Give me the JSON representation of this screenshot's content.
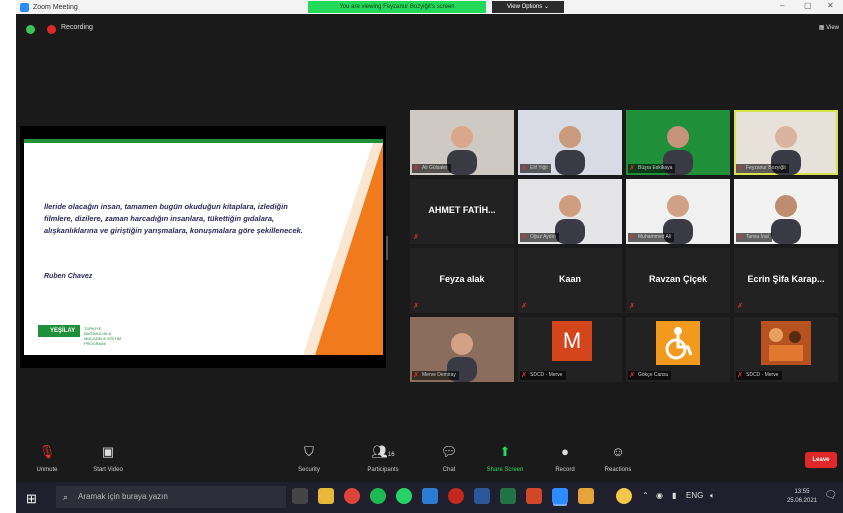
{
  "window": {
    "title": "Zoom Meeting",
    "viewing_banner": "You are viewing Feyzanur Bozyiğit's screen",
    "view_options": "View Options ⌄",
    "minimize": "–",
    "maximize": "▢",
    "close": "✕"
  },
  "meeting": {
    "recording_label": "Recording",
    "view_label": "View"
  },
  "slide": {
    "quote": "İleride olacağın insan, tamamen bugün okuduğun kitaplara, izlediğin filmlere, dizilere, zaman harcadığın insanlara, tükettiğin gıdalara, alışkanlıklarına ve giriştiğin yarışmalara, konuşmalara göre şekillenecek.",
    "author": "Ruben Chavez",
    "logo_text": "YEŞİLAY",
    "logo_sub": "TÜRKİYE BAĞIMLILIKLA MÜCADELE EĞİTİM PROGRAMI"
  },
  "participants": [
    {
      "name": "Ali Gülsaler",
      "label": "Ali Gülsaler",
      "type": "video",
      "bg": "#cfc9c4",
      "skin": "#d9a88a",
      "active": false
    },
    {
      "name": "Elif Yiğit",
      "label": "Elif Yiğit",
      "type": "video",
      "bg": "#d8dbe3",
      "skin": "#c99a7d",
      "active": false
    },
    {
      "name": "Büşra Eskikaya",
      "label": "Büşra Eskikaya",
      "type": "video",
      "bg": "#1f8f3a",
      "skin": "#c7937b",
      "active": false
    },
    {
      "name": "Feyzanur Bozyiğit",
      "label": "Feyzanur Bozyiğit",
      "type": "video",
      "bg": "#e8e1da",
      "skin": "#d8b3a0",
      "active": true
    },
    {
      "name": "AHMET FATİH...",
      "label": "",
      "type": "name",
      "active": false
    },
    {
      "name": "Oğuz Aydın",
      "label": "Oğuz Aydın",
      "type": "video",
      "bg": "#e5e5e8",
      "skin": "#cf9d80",
      "active": false
    },
    {
      "name": "Muhammed Ali",
      "label": "Muhammed Ali",
      "type": "video",
      "bg": "#f0f0f0",
      "skin": "#d0a186",
      "active": false
    },
    {
      "name": "Tansu İnal",
      "label": "Tansu İnal",
      "type": "video",
      "bg": "#f2f2f2",
      "skin": "#c08c70",
      "active": false
    },
    {
      "name": "Feyza alak",
      "label": "",
      "type": "name",
      "active": false
    },
    {
      "name": "Kaan",
      "label": "",
      "type": "name",
      "active": false
    },
    {
      "name": "Ravzan Çiçek",
      "label": "",
      "type": "name",
      "active": false
    },
    {
      "name": "Ecrin Şifa Karap...",
      "label": "",
      "type": "name",
      "active": false
    },
    {
      "name": "Merve Demiray",
      "label": "Merve Demiray",
      "type": "video",
      "bg": "#8a6d5c",
      "skin": "#d3a285",
      "active": false
    },
    {
      "name": "M",
      "label": "SDCD - Merve",
      "type": "avatar",
      "active": false
    },
    {
      "name": "Gökçe Cansu",
      "label": "Gökçe Cansu",
      "type": "wheelchair",
      "active": false
    },
    {
      "name": "SDCD - Merve",
      "label": "SDCD - Merve",
      "type": "art",
      "active": false
    }
  ],
  "controls": {
    "unmute": "Unmute",
    "start_video": "Start Video",
    "security": "Security",
    "participants": "Participants",
    "participants_count": "16",
    "chat": "Chat",
    "share_screen": "Share Screen",
    "record": "Record",
    "reactions": "Reactions",
    "leave": "Leave"
  },
  "taskbar": {
    "search_placeholder": "Aramak için buraya yazın",
    "time": "13:55",
    "date": "25.06.2021",
    "lang": "ENG"
  },
  "colors": {
    "accent_green": "#23d959",
    "leave_red": "#e02828",
    "slide_orange": "#f07a1c"
  }
}
